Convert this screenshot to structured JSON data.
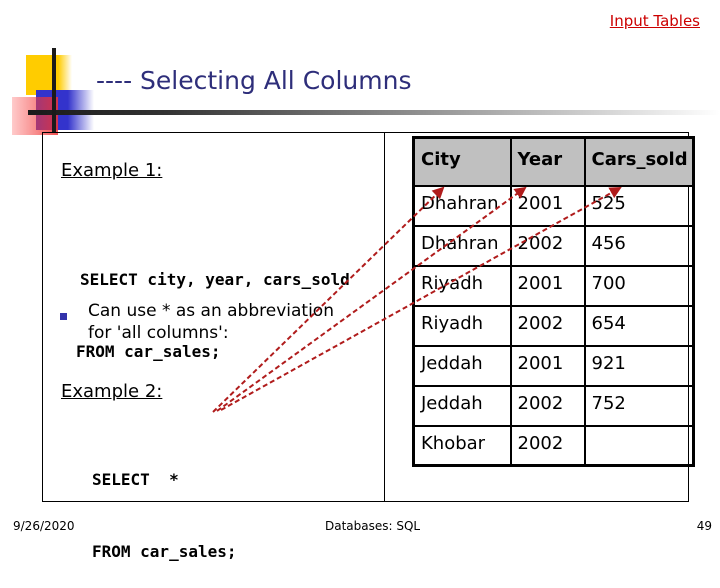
{
  "header": {
    "title": "---- Selecting All Columns",
    "link_label": "Input Tables"
  },
  "left_panel": {
    "example1_label": "Example 1:",
    "example1_code": [
      "SELECT city, year, cars_sold",
      "FROM car_sales;"
    ],
    "bullet_text": [
      "Can use * as an abbreviation",
      "for 'all columns':"
    ],
    "example2_label": "Example 2:",
    "example2_code": [
      "SELECT  *",
      "FROM car_sales;"
    ]
  },
  "table": {
    "columns": [
      "City",
      "Year",
      "Cars_sold"
    ],
    "rows": [
      [
        "Dhahran",
        "2001",
        "525"
      ],
      [
        "Dhahran",
        "2002",
        "456"
      ],
      [
        "Riyadh",
        "2001",
        "700"
      ],
      [
        "Riyadh",
        "2002",
        "654"
      ],
      [
        "Jeddah",
        "2001",
        "921"
      ],
      [
        "Jeddah",
        "2002",
        "752"
      ],
      [
        "Khobar",
        "2002",
        ""
      ]
    ]
  },
  "annotation": {
    "arrow_color": "#b01c1c",
    "description": "Dashed arrows from '*' to each column header"
  },
  "footer": {
    "date": "9/26/2020",
    "center": "Databases: SQL",
    "page_number": "49"
  }
}
